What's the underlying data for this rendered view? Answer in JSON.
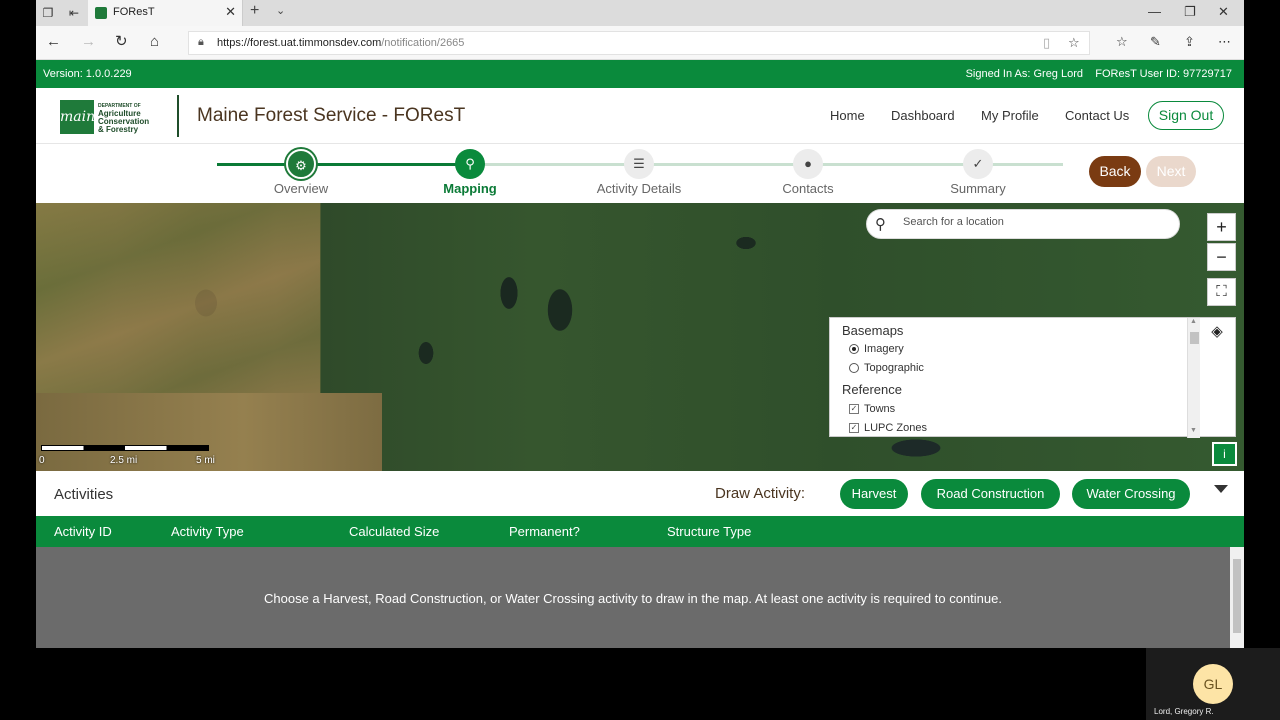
{
  "browser": {
    "tab_title": "FOResT",
    "url_host": "https://forest.uat.timmonsdev.com",
    "url_path": "/notification/2665"
  },
  "versionbar": {
    "version": "Version: 1.0.0.229",
    "signed_in": "Signed In As: Greg Lord",
    "user_id": "FOResT User ID: 97729717"
  },
  "header": {
    "logo_brand": "maine",
    "logo_dept": "DEPARTMENT OF",
    "logo_line1": "Agriculture",
    "logo_line2": "Conservation",
    "logo_line3": "& Forestry",
    "title": "Maine Forest Service - FOResT",
    "nav": [
      "Home",
      "Dashboard",
      "My Profile",
      "Contact Us"
    ],
    "sign_out": "Sign Out"
  },
  "stepper": {
    "steps": [
      {
        "label": "Overview",
        "icon": "gear-icon",
        "state": "done"
      },
      {
        "label": "Mapping",
        "icon": "map-pin-icon",
        "state": "current"
      },
      {
        "label": "Activity Details",
        "icon": "list-icon",
        "state": "todo"
      },
      {
        "label": "Contacts",
        "icon": "person-icon",
        "state": "todo"
      },
      {
        "label": "Summary",
        "icon": "check-icon",
        "state": "todo"
      }
    ],
    "back": "Back",
    "next": "Next"
  },
  "map": {
    "search_placeholder": "Search for a location",
    "zoom_in": "+",
    "zoom_out": "−",
    "info": "i",
    "layers": {
      "basemaps_heading": "Basemaps",
      "basemaps": [
        {
          "label": "Imagery",
          "selected": true
        },
        {
          "label": "Topographic",
          "selected": false
        }
      ],
      "reference_heading": "Reference",
      "reference": [
        {
          "label": "Towns",
          "checked": true
        },
        {
          "label": "LUPC Zones",
          "checked": true
        }
      ]
    },
    "scale": [
      "0",
      "2.5 mi",
      "5 mi"
    ]
  },
  "activities": {
    "title": "Activities",
    "draw_label": "Draw Activity:",
    "draw_buttons": [
      "Harvest",
      "Road Construction",
      "Water Crossing"
    ],
    "columns": [
      "Activity ID",
      "Activity Type",
      "Calculated Size",
      "Permanent?",
      "Structure Type"
    ],
    "empty_message": "Choose a Harvest, Road Construction, or Water Crossing activity to draw in the map. At least one activity is required to continue."
  },
  "participant": {
    "initials": "GL",
    "name": "Lord, Gregory R."
  },
  "colors": {
    "brand_green": "#0a8a3c",
    "back_brown": "#7a3b12",
    "title_brown": "#4a3520"
  }
}
